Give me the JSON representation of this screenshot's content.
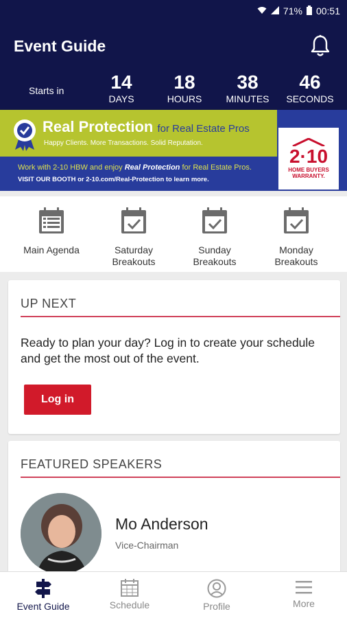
{
  "status_bar": {
    "battery": "71%",
    "time": "00:51"
  },
  "header": {
    "title": "Event Guide"
  },
  "countdown": {
    "prefix": "Starts in",
    "units": [
      {
        "value": "14",
        "label": "DAYS"
      },
      {
        "value": "18",
        "label": "HOURS"
      },
      {
        "value": "38",
        "label": "MINUTES"
      },
      {
        "value": "46",
        "label": "SECONDS"
      }
    ]
  },
  "banner": {
    "headline": "Real Protection",
    "headline_suffix": "for Real Estate Pros",
    "tagline": "Happy Clients. More Transactions. Solid Reputation.",
    "line1_prefix": "Work with 2-10 HBW and enjoy",
    "line1_emphasis": "Real Protection",
    "line1_suffix": "for Real Estate Pros.",
    "line2": "VISIT OUR BOOTH or 2-10.com/Real-Protection to learn more.",
    "logo_big": "2·10",
    "logo_small": "HOME BUYERS WARRANTY."
  },
  "quick_links": [
    {
      "label": "Main Agenda",
      "icon": "list-icon"
    },
    {
      "label": "Saturday Breakouts",
      "icon": "calendar-check-icon"
    },
    {
      "label": "Sunday Breakouts",
      "icon": "calendar-check-icon"
    },
    {
      "label": "Monday Breakouts",
      "icon": "calendar-check-icon"
    }
  ],
  "up_next": {
    "title": "UP NEXT",
    "message": "Ready to plan your day? Log in to create your schedule and get the most out of the event.",
    "button": "Log in"
  },
  "featured_speakers": {
    "title": "FEATURED SPEAKERS",
    "speakers": [
      {
        "name": "Mo Anderson",
        "role": "Vice-Chairman"
      }
    ]
  },
  "tabs": [
    {
      "label": "Event Guide",
      "icon": "signpost-icon",
      "active": true
    },
    {
      "label": "Schedule",
      "icon": "calendar-icon",
      "active": false
    },
    {
      "label": "Profile",
      "icon": "profile-icon",
      "active": false
    },
    {
      "label": "More",
      "icon": "menu-icon",
      "active": false
    }
  ],
  "colors": {
    "navy": "#11154a",
    "accent_red": "#d11a2a",
    "banner_green": "#b6c42f",
    "banner_blue": "#283c9c"
  }
}
